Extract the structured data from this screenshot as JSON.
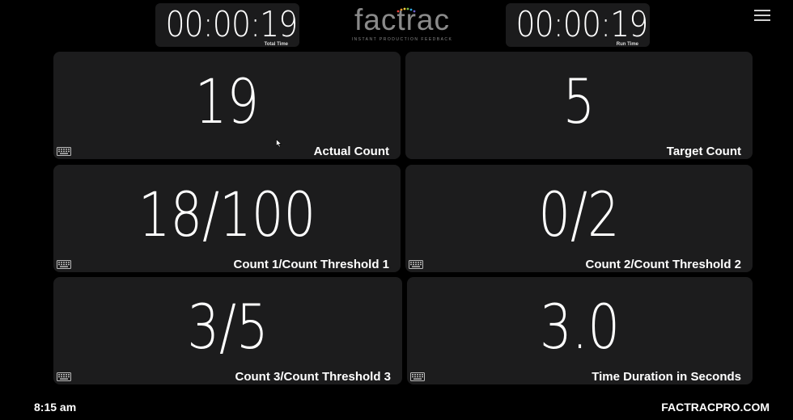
{
  "header": {
    "total_time": {
      "value": "00:00:19",
      "caption": "Total Time"
    },
    "run_time": {
      "value": "00:00:19",
      "caption": "Run Time"
    },
    "logo": {
      "word": "factrac",
      "tagline": "INSTANT PRODUCTION FEEDBACK"
    },
    "menu_icon": "hamburger-menu-icon"
  },
  "tiles": [
    {
      "value": "19",
      "label": "Actual Count",
      "icon": "keyboard-icon"
    },
    {
      "value": "5",
      "label": "Target Count",
      "icon": ""
    },
    {
      "value": "18/100",
      "label": "Count 1/Count Threshold 1",
      "icon": "keyboard-icon"
    },
    {
      "value": "0/2",
      "label": "Count 2/Count Threshold 2",
      "icon": "keyboard-icon"
    },
    {
      "value": "3/5",
      "label": "Count 3/Count Threshold 3",
      "icon": "keyboard-icon"
    },
    {
      "value": "3.0",
      "label": "Time Duration in Seconds",
      "icon": "keyboard-icon"
    }
  ],
  "footer": {
    "clock": "8:15 am",
    "site": "FACTRACPRO.COM"
  },
  "colors": {
    "background": "#000000",
    "tile": "#1c1c1d",
    "text": "#ffffff",
    "logo_dots": [
      "#e8423a",
      "#f39a2b",
      "#f7d13b",
      "#7dc242",
      "#2fa8e0",
      "#6a5cc9"
    ]
  }
}
